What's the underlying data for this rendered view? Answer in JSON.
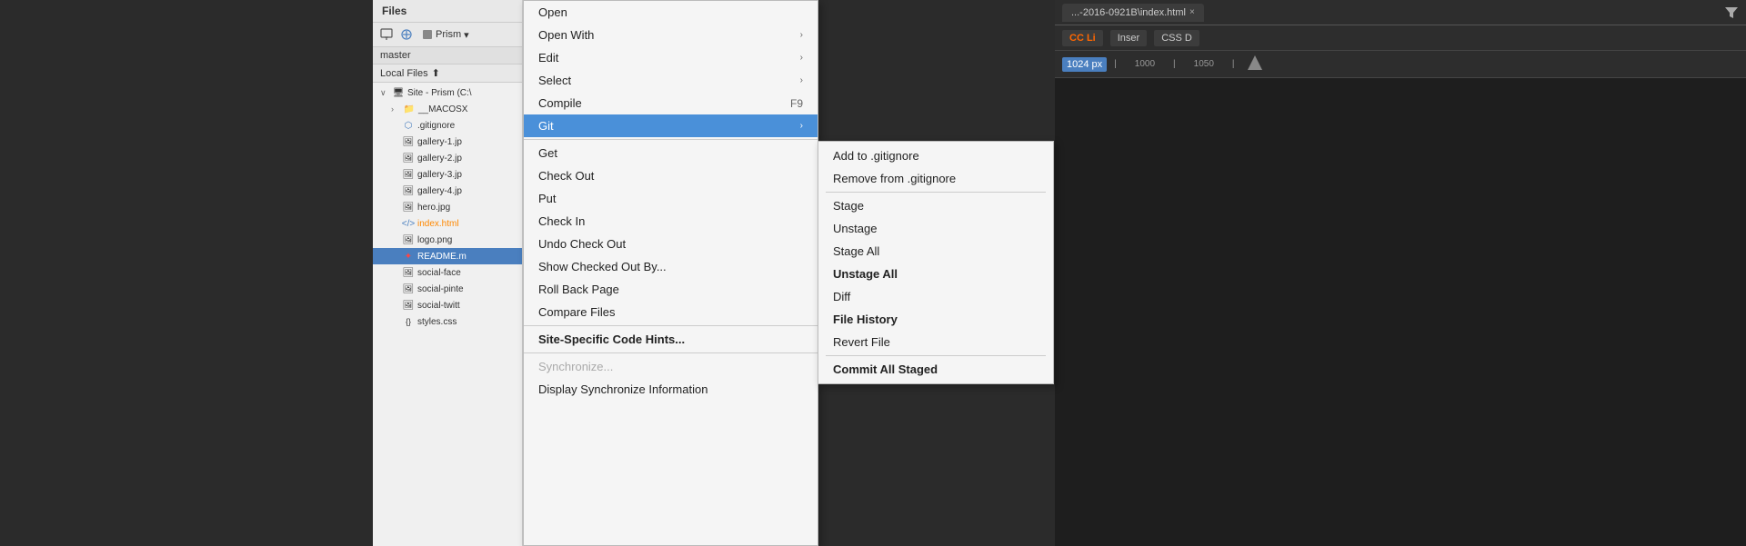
{
  "filesPanel": {
    "header": "Files",
    "prismLabel": "Prism",
    "branch": "master",
    "localFiles": "Local Files",
    "items": [
      {
        "name": "Site - Prism (C:\\",
        "type": "site",
        "depth": 0
      },
      {
        "name": "__MACOSX",
        "type": "folder",
        "depth": 1
      },
      {
        "name": ".gitignore",
        "type": "file-git",
        "depth": 2
      },
      {
        "name": "gallery-1.jp",
        "type": "image",
        "depth": 2
      },
      {
        "name": "gallery-2.jp",
        "type": "image",
        "depth": 2
      },
      {
        "name": "gallery-3.jp",
        "type": "image",
        "depth": 2
      },
      {
        "name": "gallery-4.jp",
        "type": "image",
        "depth": 2
      },
      {
        "name": "hero.jpg",
        "type": "image",
        "depth": 2
      },
      {
        "name": "index.html",
        "type": "html",
        "depth": 2,
        "highlight": "orange"
      },
      {
        "name": "logo.png",
        "type": "image",
        "depth": 2
      },
      {
        "name": "README.m",
        "type": "file-red",
        "depth": 2,
        "highlight": "red"
      },
      {
        "name": "social-face",
        "type": "image",
        "depth": 2
      },
      {
        "name": "social-pinte",
        "type": "image",
        "depth": 2
      },
      {
        "name": "social-twitt",
        "type": "image",
        "depth": 2
      },
      {
        "name": "styles.css",
        "type": "css",
        "depth": 2
      }
    ]
  },
  "contextMenu": {
    "items": [
      {
        "label": "Open",
        "hasSubmenu": false,
        "shortcut": ""
      },
      {
        "label": "Open With",
        "hasSubmenu": true,
        "shortcut": ""
      },
      {
        "label": "Edit",
        "hasSubmenu": true,
        "shortcut": ""
      },
      {
        "label": "Select",
        "hasSubmenu": true,
        "shortcut": ""
      },
      {
        "label": "Compile",
        "hasSubmenu": false,
        "shortcut": "F9"
      },
      {
        "label": "Git",
        "hasSubmenu": true,
        "shortcut": "",
        "active": true
      },
      {
        "separator": true
      },
      {
        "label": "Get",
        "hasSubmenu": false,
        "shortcut": ""
      },
      {
        "label": "Check Out",
        "hasSubmenu": false,
        "shortcut": ""
      },
      {
        "label": "Put",
        "hasSubmenu": false,
        "shortcut": ""
      },
      {
        "label": "Check In",
        "hasSubmenu": false,
        "shortcut": ""
      },
      {
        "label": "Undo Check Out",
        "hasSubmenu": false,
        "shortcut": ""
      },
      {
        "label": "Show Checked Out By...",
        "hasSubmenu": false,
        "shortcut": ""
      },
      {
        "label": "Roll Back Page",
        "hasSubmenu": false,
        "shortcut": ""
      },
      {
        "label": "Compare Files",
        "hasSubmenu": false,
        "shortcut": ""
      },
      {
        "separator2": true
      },
      {
        "label": "Site-Specific Code Hints...",
        "hasSubmenu": false,
        "shortcut": "",
        "bold": true
      },
      {
        "separator3": true
      },
      {
        "label": "Synchronize...",
        "hasSubmenu": false,
        "shortcut": "",
        "disabled": true
      },
      {
        "label": "Display Synchronize Information",
        "hasSubmenu": false,
        "shortcut": ""
      }
    ]
  },
  "gitSubmenu": {
    "items": [
      {
        "label": "Add to .gitignore",
        "bold": false
      },
      {
        "label": "Remove from .gitignore",
        "bold": false
      },
      {
        "separator": true
      },
      {
        "label": "Stage",
        "bold": false
      },
      {
        "label": "Unstage",
        "bold": false
      },
      {
        "label": "Stage All",
        "bold": false
      },
      {
        "label": "Unstage All",
        "bold": true
      },
      {
        "label": "Diff",
        "bold": false
      },
      {
        "label": "File History",
        "bold": true
      },
      {
        "label": "Revert File",
        "bold": false
      },
      {
        "separator2": true
      },
      {
        "label": "Commit All Staged",
        "bold": true
      }
    ]
  },
  "editorTab": {
    "filename": "...-2016-0921B\\index.html",
    "closeIcon": "×"
  },
  "ruler": {
    "pxValue": "1024",
    "pxLabel": "px",
    "markers": [
      "1000",
      "1050"
    ]
  }
}
